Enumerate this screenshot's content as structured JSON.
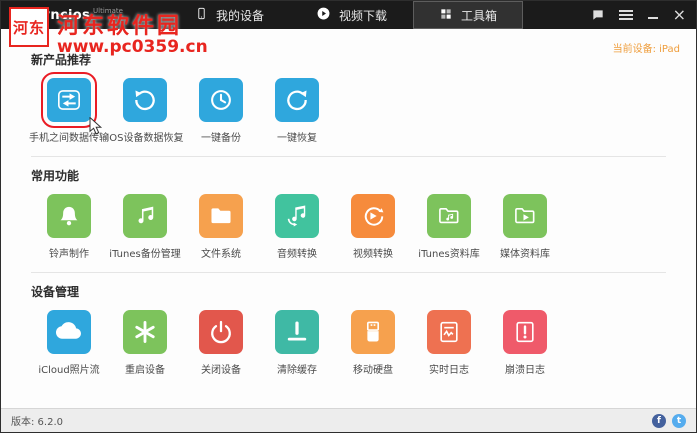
{
  "window": {
    "brand": "Syncios",
    "brand_suffix": "Ultimate",
    "nav": [
      {
        "id": "my-devices",
        "label": "我的设备"
      },
      {
        "id": "video-download",
        "label": "视频下载"
      },
      {
        "id": "toolbox",
        "label": "工具箱",
        "active": true
      }
    ],
    "current_device_label": "当前设备: iPad"
  },
  "watermark": {
    "logo_text": "河东",
    "site_name": "河东软件园",
    "site_url": "www.pc0359.cn"
  },
  "sections": [
    {
      "id": "new-products",
      "title": "新产品推荐",
      "items": [
        {
          "id": "phone-data-transfer",
          "label": "手机之间数据传输",
          "icon": "transfer-arrows",
          "color": "#2fa7dd",
          "highlighted": true
        },
        {
          "id": "ios-data-recovery",
          "label": "iOS设备数据恢复",
          "icon": "data-recovery",
          "color": "#2fa7dd"
        },
        {
          "id": "one-key-backup",
          "label": "一键备份",
          "icon": "backup-clock",
          "color": "#2fa7dd"
        },
        {
          "id": "one-key-restore",
          "label": "一键恢复",
          "icon": "restore-arrow",
          "color": "#2fa7dd"
        }
      ]
    },
    {
      "id": "common-functions",
      "title": "常用功能",
      "items": [
        {
          "id": "ringtone-maker",
          "label": "铃声制作",
          "icon": "bell",
          "color": "#7dc35c"
        },
        {
          "id": "itunes-backup-manager",
          "label": "iTunes备份管理",
          "icon": "music-note",
          "color": "#7dc35c"
        },
        {
          "id": "file-system",
          "label": "文件系统",
          "icon": "folder",
          "color": "#f6a14e"
        },
        {
          "id": "audio-converter",
          "label": "音频转换",
          "icon": "audio-convert",
          "color": "#41c39e"
        },
        {
          "id": "video-converter",
          "label": "视频转换",
          "icon": "video-convert",
          "color": "#f68b3c"
        },
        {
          "id": "itunes-library",
          "label": "iTunes资料库",
          "icon": "folder-music",
          "color": "#7dc35c"
        },
        {
          "id": "media-library",
          "label": "媒体资料库",
          "icon": "folder-play",
          "color": "#7dc35c"
        }
      ]
    },
    {
      "id": "device-management",
      "title": "设备管理",
      "items": [
        {
          "id": "icloud-photo-stream",
          "label": "iCloud照片流",
          "icon": "cloud",
          "color": "#2fa7dd"
        },
        {
          "id": "restart-device",
          "label": "重启设备",
          "icon": "asterisk",
          "color": "#7dc35c"
        },
        {
          "id": "shutdown-device",
          "label": "关闭设备",
          "icon": "power",
          "color": "#e2574c"
        },
        {
          "id": "clear-cache",
          "label": "清除缓存",
          "icon": "eject",
          "color": "#3fb9a5"
        },
        {
          "id": "mobile-disk",
          "label": "移动硬盘",
          "icon": "usb",
          "color": "#f6a14e"
        },
        {
          "id": "realtime-log",
          "label": "实时日志",
          "icon": "log-pulse",
          "color": "#ee7151"
        },
        {
          "id": "crash-log",
          "label": "崩溃日志",
          "icon": "log-alert",
          "color": "#ef5a6a"
        }
      ]
    }
  ],
  "footer": {
    "version_label": "版本: 6.2.0",
    "socials": [
      {
        "id": "facebook",
        "glyph": "f"
      },
      {
        "id": "twitter",
        "glyph": "t"
      }
    ]
  }
}
